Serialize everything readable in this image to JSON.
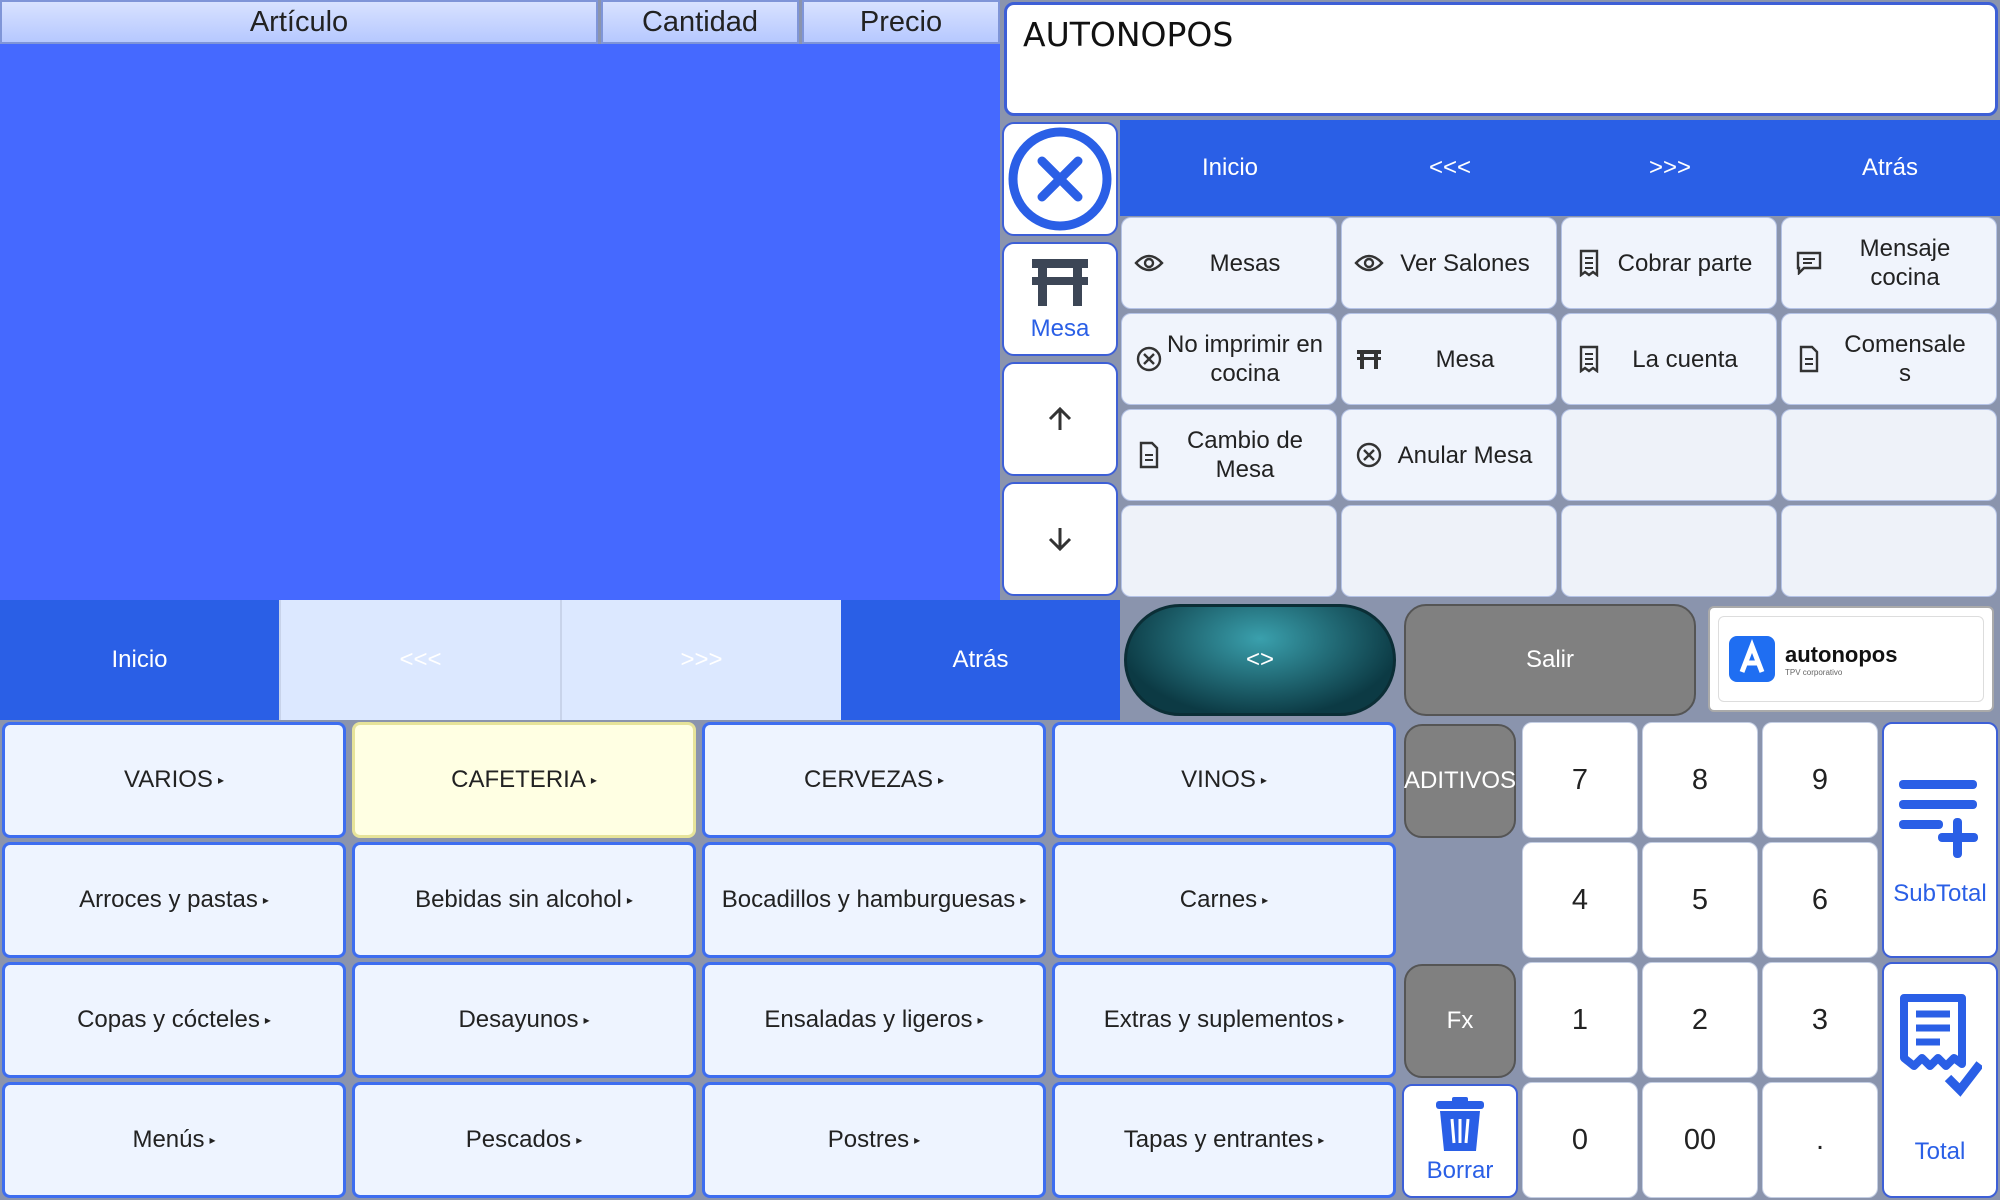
{
  "order": {
    "columns": [
      "Artículo",
      "Cantidad",
      "Precio"
    ]
  },
  "display": {
    "text": "AUTONOPOS"
  },
  "side": {
    "mesa_label": "Mesa"
  },
  "top_nav": {
    "inicio": "Inicio",
    "prev": "<<<",
    "next": ">>>",
    "atras": "Atrás"
  },
  "functions": [
    {
      "label": "Mesas",
      "icon": "eye-icon"
    },
    {
      "label": "Ver Salones",
      "icon": "eye-icon"
    },
    {
      "label": "Cobrar parte",
      "icon": "receipt-icon"
    },
    {
      "label": "Mensaje cocina",
      "icon": "message-icon"
    },
    {
      "label": "No imprimir en cocina",
      "icon": "cancel-circle-icon"
    },
    {
      "label": "Mesa",
      "icon": "table-icon"
    },
    {
      "label": "La cuenta",
      "icon": "receipt-icon"
    },
    {
      "label": "Comensales",
      "icon": "document-icon"
    },
    {
      "label": "Cambio de Mesa",
      "icon": "document-icon"
    },
    {
      "label": "Anular Mesa",
      "icon": "cancel-circle-icon"
    }
  ],
  "bottom_nav": {
    "inicio": "Inicio",
    "prev": "<<<",
    "next": ">>>",
    "atras": "Atrás"
  },
  "toggle_label": "<>",
  "salir_label": "Salir",
  "logo": {
    "name": "autonopos",
    "tagline": "TPV corporativo"
  },
  "categories": [
    "VARIOS",
    "CAFETERIA",
    "CERVEZAS",
    "VINOS",
    "Arroces y pastas",
    "Bebidas sin alcohol",
    "Bocadillos y hamburguesas",
    "Carnes",
    "Copas y cócteles",
    "Desayunos",
    "Ensaladas y ligeros",
    "Extras y suplementos",
    "Menús",
    "Pescados",
    "Postres",
    "Tapas y entrantes"
  ],
  "selected_category": "CAFETERIA",
  "keypad": {
    "aditivos": "ADITIVOS",
    "fx": "Fx",
    "borrar": "Borrar",
    "digits": [
      "7",
      "8",
      "9",
      "4",
      "5",
      "6",
      "1",
      "2",
      "3",
      "0",
      "00",
      "."
    ],
    "subtotal": "SubTotal",
    "total": "Total"
  }
}
